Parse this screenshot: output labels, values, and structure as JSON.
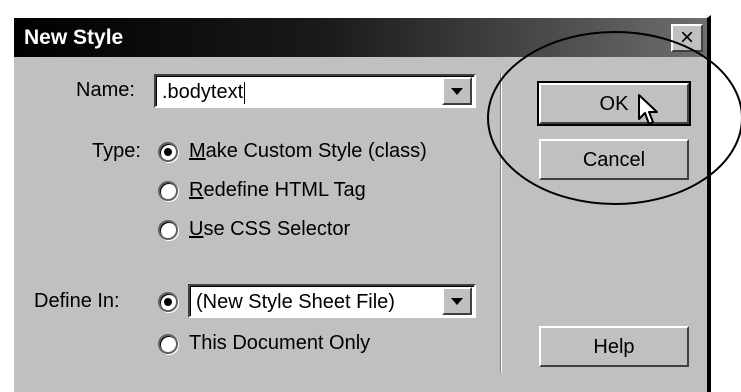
{
  "dialog": {
    "title": "New Style",
    "close_label": "×",
    "name_label": "Name:",
    "name_value": ".bodytext",
    "type_label": "Type:",
    "type_options": [
      {
        "mn": "M",
        "rest": "ake Custom Style (class)",
        "selected": true
      },
      {
        "mn": "R",
        "rest": "edefine HTML Tag",
        "selected": false
      },
      {
        "mn": "U",
        "rest": "se CSS Selector",
        "selected": false
      }
    ],
    "define_label": "Define In:",
    "define_select_value": "(New Style Sheet File)",
    "define_option_document": "This Document Only",
    "ok_label": "OK",
    "cancel_label": "Cancel",
    "help_label": "Help"
  }
}
